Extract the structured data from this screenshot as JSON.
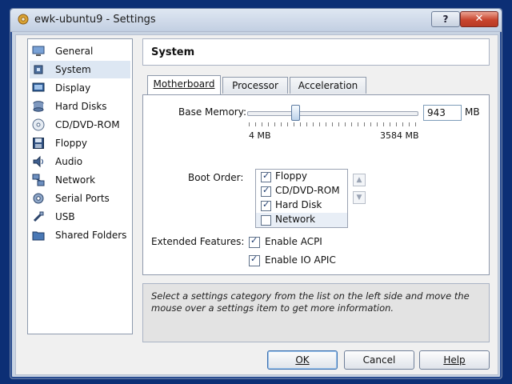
{
  "window": {
    "title": "ewk-ubuntu9 - Settings",
    "help_button": "?",
    "close_button": "✕"
  },
  "sidebar": {
    "items": [
      {
        "label": "General",
        "icon": "monitor-icon"
      },
      {
        "label": "System",
        "icon": "chip-icon",
        "selected": true
      },
      {
        "label": "Display",
        "icon": "display-icon"
      },
      {
        "label": "Hard Disks",
        "icon": "disk-stack-icon"
      },
      {
        "label": "CD/DVD-ROM",
        "icon": "cd-icon"
      },
      {
        "label": "Floppy",
        "icon": "floppy-icon"
      },
      {
        "label": "Audio",
        "icon": "speaker-icon"
      },
      {
        "label": "Network",
        "icon": "network-icon"
      },
      {
        "label": "Serial Ports",
        "icon": "serial-port-icon"
      },
      {
        "label": "USB",
        "icon": "usb-icon"
      },
      {
        "label": "Shared Folders",
        "icon": "folder-icon"
      }
    ]
  },
  "main": {
    "section_title": "System",
    "tabs": [
      {
        "label": "Motherboard",
        "active": true
      },
      {
        "label": "Processor"
      },
      {
        "label": "Acceleration"
      }
    ],
    "base_memory": {
      "label": "Base Memory:",
      "value": "943",
      "unit": "MB",
      "min_label": "4 MB",
      "max_label": "3584 MB"
    },
    "boot_order": {
      "label": "Boot Order:",
      "items": [
        {
          "label": "Floppy",
          "checked": true
        },
        {
          "label": "CD/DVD-ROM",
          "checked": true
        },
        {
          "label": "Hard Disk",
          "checked": true
        },
        {
          "label": "Network",
          "checked": false
        }
      ],
      "up_arrow": "▲",
      "down_arrow": "▼"
    },
    "extended_features": {
      "label": "Extended Features:",
      "enable_acpi": {
        "label": "Enable ACPI",
        "checked": true
      },
      "enable_io_apic": {
        "label": "Enable IO APIC",
        "checked": true
      }
    },
    "info_text": "Select a settings category from the list on the left side and move the mouse over a settings item to get more information."
  },
  "footer": {
    "ok": "OK",
    "cancel": "Cancel",
    "help": "Help"
  },
  "colors": {
    "desktop_background": "#0c2f75",
    "window_frame": "#c9d4e3",
    "close_button": "#c8452e",
    "selection": "#dde7f3"
  }
}
